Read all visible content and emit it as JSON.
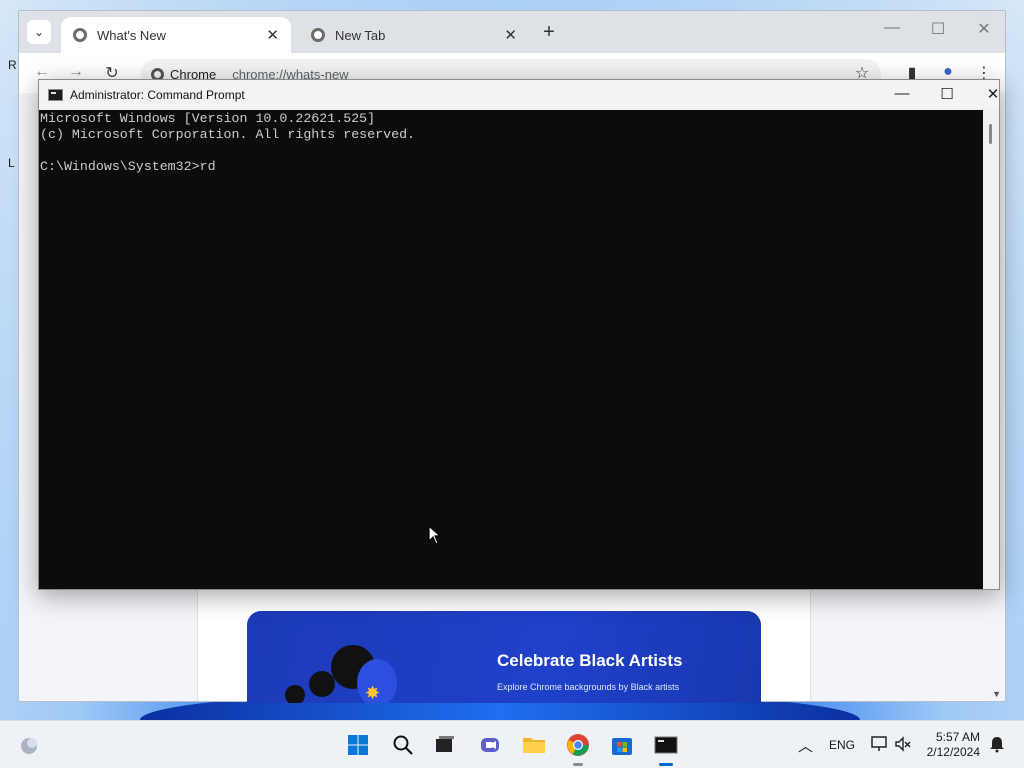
{
  "desktop": {
    "icon_text_1": "R",
    "icon_text_2": "L"
  },
  "browser": {
    "tabs": [
      {
        "label": "What's New",
        "active": true
      },
      {
        "label": "New Tab",
        "active": false
      }
    ],
    "omnibox": {
      "chip_label": "Chrome",
      "url": "chrome://whats-new"
    },
    "banner": {
      "title": "Celebrate Black Artists",
      "subtitle": "Explore Chrome backgrounds by Black artists"
    }
  },
  "cmd": {
    "title": "Administrator: Command Prompt",
    "lines": [
      "Microsoft Windows [Version 10.0.22621.525]",
      "(c) Microsoft Corporation. All rights reserved.",
      "",
      "C:\\Windows\\System32>rd"
    ]
  },
  "taskbar": {
    "language": "ENG",
    "time": "5:57 AM",
    "date": "2/12/2024"
  },
  "colors": {
    "console_bg": "#0c0c0c",
    "console_fg": "#cccccc",
    "accent": "#0a64d0",
    "banner": "#1f40c9"
  }
}
